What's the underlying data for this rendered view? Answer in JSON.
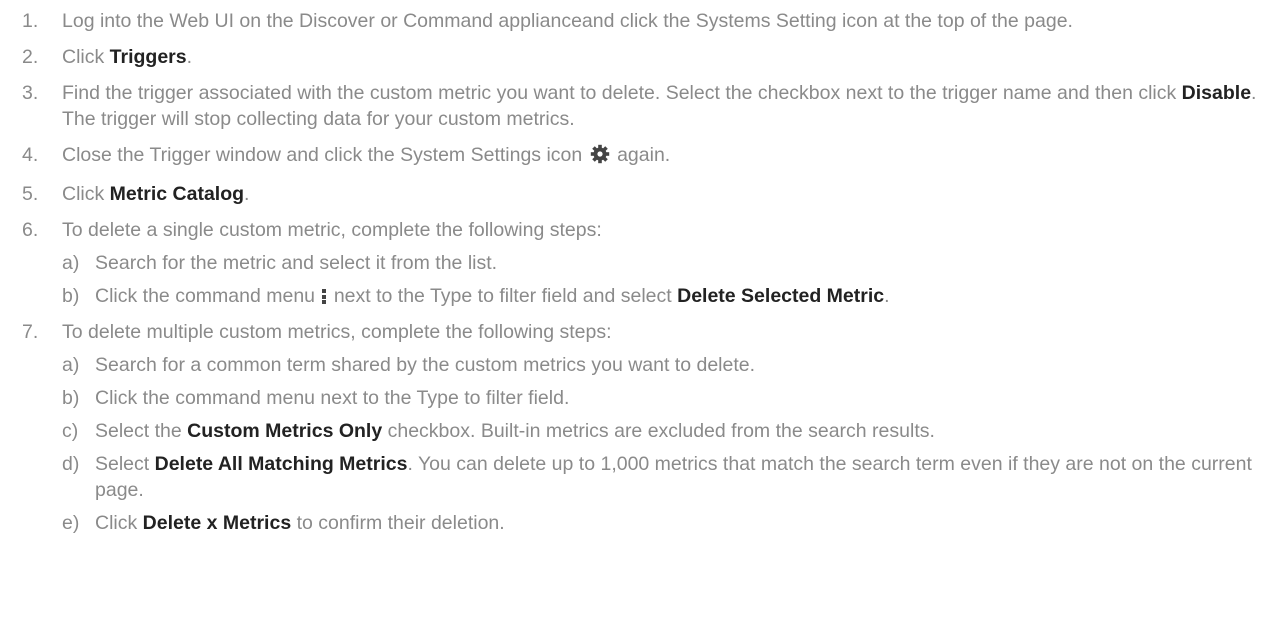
{
  "steps": [
    {
      "num": "1.",
      "parts": [
        {
          "t": "text",
          "v": "Log into the Web UI on the Discover or Command applianceand click the Systems Setting icon at the top of the page."
        }
      ]
    },
    {
      "num": "2.",
      "parts": [
        {
          "t": "text",
          "v": "Click "
        },
        {
          "t": "bold",
          "v": "Triggers"
        },
        {
          "t": "text",
          "v": "."
        }
      ]
    },
    {
      "num": "3.",
      "parts": [
        {
          "t": "text",
          "v": "Find the trigger associated with the custom metric you want to delete. Select the checkbox next to the trigger name and then click "
        },
        {
          "t": "bold",
          "v": "Disable"
        },
        {
          "t": "text",
          "v": ". The trigger will stop collecting data for your custom metrics."
        }
      ]
    },
    {
      "num": "4.",
      "parts": [
        {
          "t": "text",
          "v": "Close the Trigger window and click the System Settings icon "
        },
        {
          "t": "icon",
          "v": "gear-icon"
        },
        {
          "t": "text",
          "v": " again."
        }
      ]
    },
    {
      "num": "5.",
      "parts": [
        {
          "t": "text",
          "v": "Click "
        },
        {
          "t": "bold",
          "v": "Metric Catalog"
        },
        {
          "t": "text",
          "v": "."
        }
      ]
    },
    {
      "num": "6.",
      "parts": [
        {
          "t": "text",
          "v": "To delete a single custom metric, complete the following steps:"
        }
      ],
      "substeps": [
        {
          "letter": "a)",
          "parts": [
            {
              "t": "text",
              "v": "Search for the metric and select it from the list."
            }
          ]
        },
        {
          "letter": "b)",
          "parts": [
            {
              "t": "text",
              "v": "Click the command menu "
            },
            {
              "t": "icon",
              "v": "kebab-menu-icon"
            },
            {
              "t": "text",
              "v": " next to the Type to filter field and select "
            },
            {
              "t": "bold",
              "v": "Delete Selected Metric"
            },
            {
              "t": "text",
              "v": "."
            }
          ]
        }
      ]
    },
    {
      "num": "7.",
      "parts": [
        {
          "t": "text",
          "v": "To delete multiple custom metrics, complete the following steps:"
        }
      ],
      "substeps": [
        {
          "letter": "a)",
          "parts": [
            {
              "t": "text",
              "v": "Search for a common term shared by the custom metrics you want to delete."
            }
          ]
        },
        {
          "letter": "b)",
          "parts": [
            {
              "t": "text",
              "v": "Click the command menu next to the Type to filter field."
            }
          ]
        },
        {
          "letter": "c)",
          "parts": [
            {
              "t": "text",
              "v": "Select the "
            },
            {
              "t": "bold",
              "v": "Custom Metrics Only"
            },
            {
              "t": "text",
              "v": " checkbox. Built-in metrics are excluded from the search results."
            }
          ]
        },
        {
          "letter": "d)",
          "parts": [
            {
              "t": "text",
              "v": "Select "
            },
            {
              "t": "bold",
              "v": "Delete All Matching Metrics"
            },
            {
              "t": "text",
              "v": ". You can delete up to 1,000 metrics that match the search term even if they are not on the current page."
            }
          ]
        },
        {
          "letter": "e)",
          "parts": [
            {
              "t": "text",
              "v": "Click "
            },
            {
              "t": "bold",
              "v": "Delete x Metrics"
            },
            {
              "t": "text",
              "v": " to confirm their deletion."
            }
          ]
        }
      ]
    }
  ]
}
